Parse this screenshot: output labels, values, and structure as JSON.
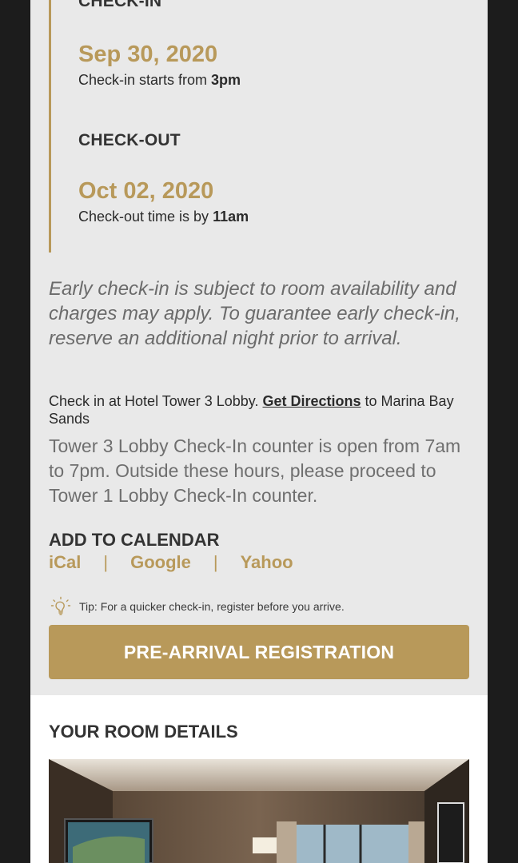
{
  "checkin": {
    "label": "CHECK-IN",
    "date": "Sep 30, 2020",
    "note_prefix": "Check-in starts from ",
    "note_time": "3pm"
  },
  "checkout": {
    "label": "CHECK-OUT",
    "date": "Oct 02, 2020",
    "note_prefix": "Check-out time is by ",
    "note_time": "11am"
  },
  "early_checkin_note": "Early check-in is subject to room availability and charges may apply. To guarantee early check-in, reserve an additional night prior to arrival.",
  "location": {
    "prefix": "Check in at Hotel Tower 3 Lobby. ",
    "link": "Get Directions",
    "suffix": " to Marina Bay Sands"
  },
  "counter_note": "Tower 3 Lobby Check-In counter is open from 7am to 7pm. Outside these hours, please proceed to Tower 1 Lobby Check-In counter.",
  "calendar": {
    "title": "ADD TO CALENDAR",
    "links": [
      "iCal",
      "Google",
      "Yahoo"
    ],
    "separator": "|"
  },
  "tip": {
    "icon": "lightbulb-icon",
    "text": "Tip: For a quicker check-in, register before you arrive."
  },
  "registration_button": "PRE-ARRIVAL REGISTRATION",
  "room_details": {
    "title": "YOUR ROOM DETAILS"
  },
  "colors": {
    "accent_gold": "#b8995a",
    "card_bg": "#e9e9e9",
    "page_bg": "#1c1c1c"
  }
}
